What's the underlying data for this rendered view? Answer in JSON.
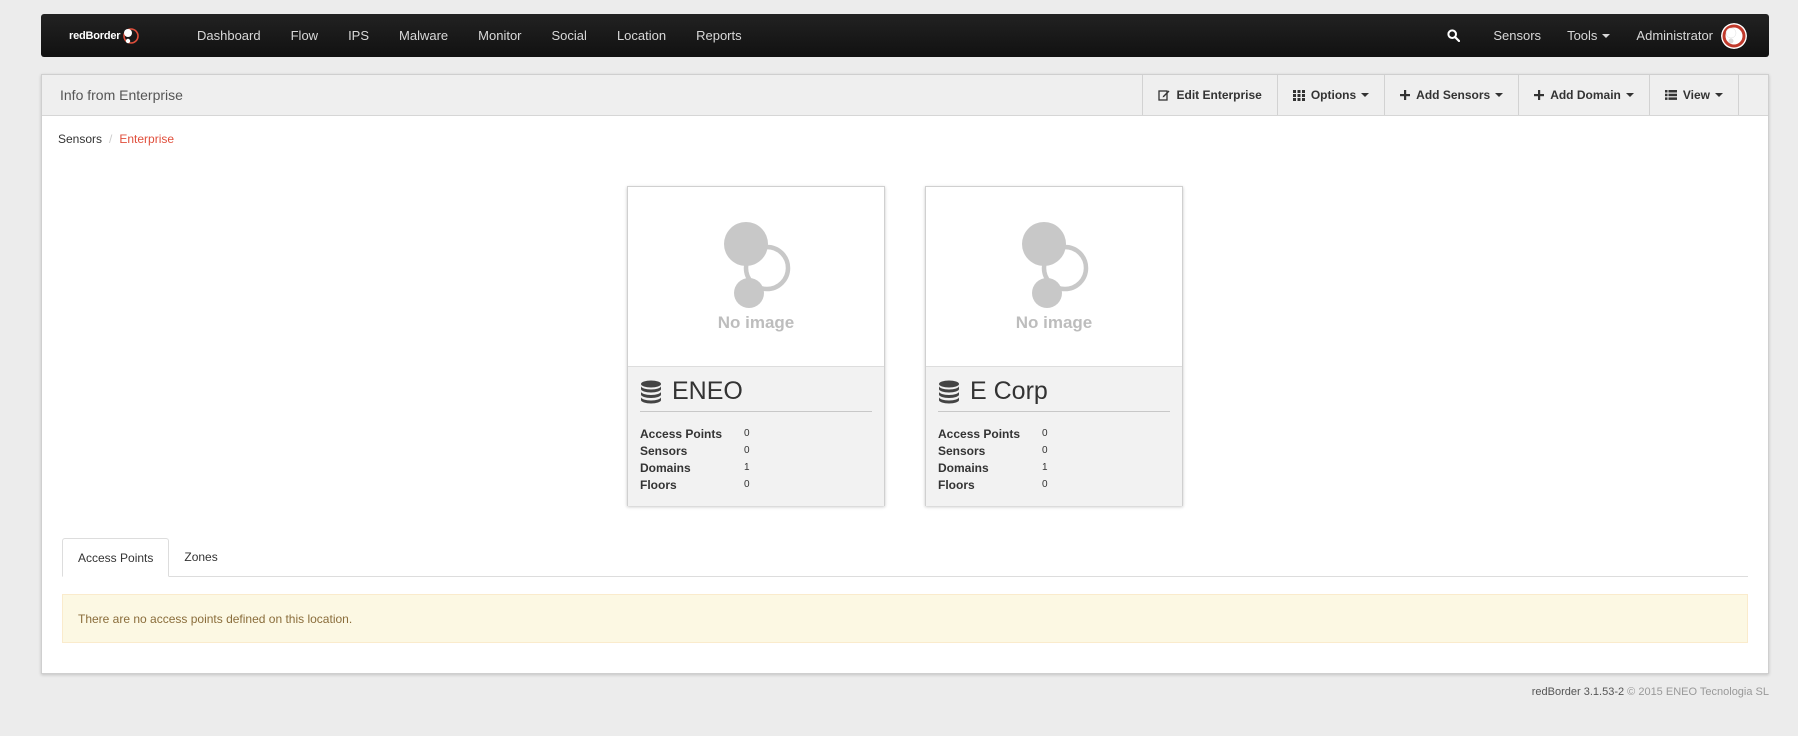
{
  "nav": {
    "brand": "redBorder",
    "items": [
      "Dashboard",
      "Flow",
      "IPS",
      "Malware",
      "Monitor",
      "Social",
      "Location",
      "Reports"
    ],
    "right": {
      "sensors": "Sensors",
      "tools": "Tools",
      "user": "Administrator"
    }
  },
  "panel": {
    "title": "Info from Enterprise",
    "toolbar": {
      "edit": "Edit Enterprise",
      "options": "Options",
      "add_sensors": "Add Sensors",
      "add_domain": "Add Domain",
      "view": "View"
    }
  },
  "breadcrumb": {
    "root": "Sensors",
    "current": "Enterprise"
  },
  "cards": [
    {
      "no_image": "No image",
      "title": "ENEO",
      "stats": [
        {
          "label": "Access Points",
          "value": "0"
        },
        {
          "label": "Sensors",
          "value": "0"
        },
        {
          "label": "Domains",
          "value": "1"
        },
        {
          "label": "Floors",
          "value": "0"
        }
      ]
    },
    {
      "no_image": "No image",
      "title": "E Corp",
      "stats": [
        {
          "label": "Access Points",
          "value": "0"
        },
        {
          "label": "Sensors",
          "value": "0"
        },
        {
          "label": "Domains",
          "value": "1"
        },
        {
          "label": "Floors",
          "value": "0"
        }
      ]
    }
  ],
  "tabs": [
    "Access Points",
    "Zones"
  ],
  "alert": "There are no access points defined on this location.",
  "footer": {
    "version": "redBorder 3.1.53-2",
    "copyright": "© 2015 ENEO Tecnologia SL"
  },
  "colors": {
    "accent": "#e04f3c",
    "navbar": "#1a1a1a",
    "alert_bg": "#fcf8e3"
  }
}
